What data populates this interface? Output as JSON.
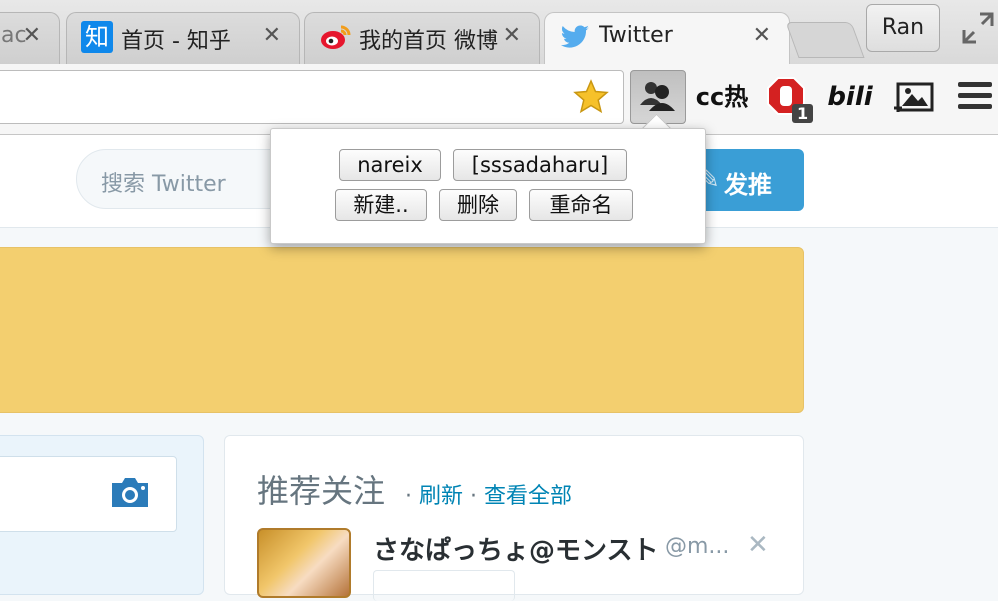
{
  "tabs": [
    {
      "title": "ac",
      "close": "✕"
    },
    {
      "title": "首页 - 知乎",
      "favicon_text": "知",
      "close": "✕"
    },
    {
      "title": "我的首页 微博",
      "close": "✕"
    },
    {
      "title": "Twitter",
      "close": "✕"
    }
  ],
  "profile_button": "Ran",
  "extensions": {
    "text_ext": "cc热",
    "bili_label": "bili",
    "adblock_badge": "1"
  },
  "popup": {
    "accounts": [
      "nareix",
      "[sssadaharu]"
    ],
    "actions": [
      "新建..",
      "删除",
      "重命名"
    ]
  },
  "twitter": {
    "search_placeholder": "搜索 Twitter",
    "tweet_button": "发推",
    "who_to_follow": {
      "title": "推荐关注",
      "separator1": " · ",
      "refresh": "刷新",
      "separator2": " · ",
      "view_all": "查看全部",
      "name": "さなぱっちょ@モンスト",
      "handle": "@m...",
      "dismiss": "✕"
    }
  },
  "colors": {
    "twitter_blue": "#3a9ed6",
    "banner_yellow": "#f3cf6f",
    "link_blue": "#0084b4"
  },
  "icons": [
    "zhihu-favicon",
    "weibo-favicon",
    "twitter-favicon",
    "bookmark-star-icon",
    "users-icon",
    "adblock-icon",
    "image-icon",
    "menu-icon",
    "camera-icon",
    "close-icon",
    "fullscreen-icon"
  ]
}
